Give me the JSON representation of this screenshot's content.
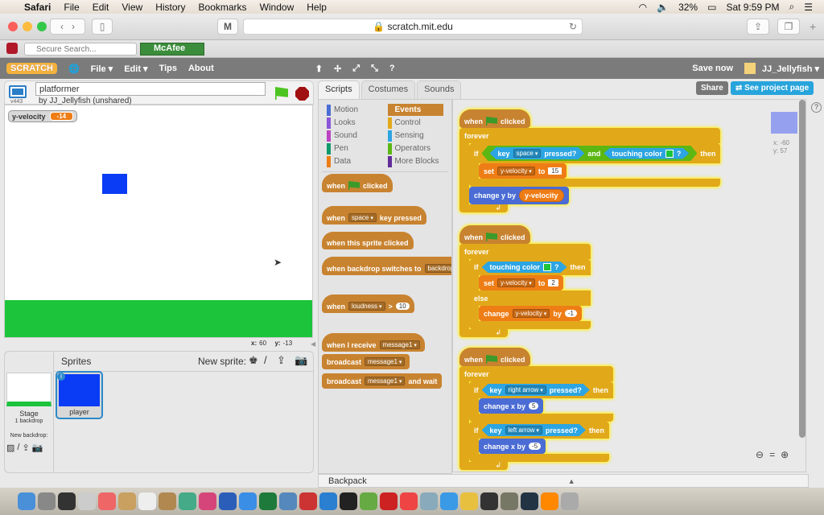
{
  "mac_menu": {
    "apple": "",
    "app": "Safari",
    "items": [
      "File",
      "Edit",
      "View",
      "History",
      "Bookmarks",
      "Window",
      "Help"
    ],
    "battery": "32%",
    "clock": "Sat 9:59 PM"
  },
  "browser": {
    "url": "scratch.mit.edu",
    "search_placeholder": "Secure Search...",
    "mcafee": "McAfee",
    "m_label": "M"
  },
  "scratch_menu": {
    "logo": "SCRATCH",
    "items": [
      "File ▾",
      "Edit ▾",
      "Tips",
      "About"
    ],
    "save": "Save now",
    "user": "JJ_Jellyfish ▾",
    "share": "Share",
    "see_project": "See project page"
  },
  "project": {
    "title": "platformer",
    "author": "by JJ_Jellyfish (unshared)",
    "version": "v443"
  },
  "stage": {
    "monitor_label": "y-velocity",
    "monitor_value": "-14",
    "x_label": "x:",
    "x": "60",
    "y_label": "y:",
    "y": "-13",
    "floor_color": "#1cc43c",
    "player_color": "#0a3cf5"
  },
  "sprites": {
    "title": "Sprites",
    "new_sprite": "New sprite:",
    "stage_label": "Stage",
    "backdrops": "1 backdrop",
    "new_backdrop": "New backdrop:",
    "items": [
      {
        "name": "player"
      }
    ]
  },
  "tabs": [
    "Scripts",
    "Costumes",
    "Sounds"
  ],
  "categories": [
    {
      "name": "Motion",
      "color": "#4a6cd4"
    },
    {
      "name": "Events",
      "color": "#c88330",
      "selected": true
    },
    {
      "name": "Looks",
      "color": "#8a55d7"
    },
    {
      "name": "Control",
      "color": "#e1a91a"
    },
    {
      "name": "Sound",
      "color": "#bb42c3"
    },
    {
      "name": "Sensing",
      "color": "#2ca5e2"
    },
    {
      "name": "Pen",
      "color": "#0e9a6c"
    },
    {
      "name": "Operators",
      "color": "#5cb712"
    },
    {
      "name": "Data",
      "color": "#ee7d16"
    },
    {
      "name": "More Blocks",
      "color": "#632d99"
    }
  ],
  "palette_blocks": [
    {
      "hat": true,
      "cat": "events",
      "parts": [
        "when",
        {
          "icon": "green-flag"
        },
        "clicked"
      ]
    },
    {
      "hat": true,
      "cat": "events",
      "parts": [
        "when",
        {
          "dd": "space"
        },
        "key pressed"
      ]
    },
    {
      "hat": true,
      "cat": "events",
      "parts": [
        "when this sprite clicked"
      ]
    },
    {
      "hat": true,
      "cat": "events",
      "parts": [
        "when backdrop switches to",
        {
          "dd": "backdrop"
        }
      ]
    },
    {
      "hat": true,
      "cat": "events",
      "parts": [
        "when",
        {
          "dd": "loudness"
        },
        ">",
        {
          "num": "10"
        }
      ]
    },
    {
      "hat": true,
      "cat": "events",
      "parts": [
        "when I receive",
        {
          "dd": "message1"
        }
      ]
    },
    {
      "cat": "events",
      "parts": [
        "broadcast",
        {
          "dd": "message1"
        }
      ]
    },
    {
      "cat": "events",
      "parts": [
        "broadcast",
        {
          "dd": "message1"
        },
        "and wait"
      ]
    }
  ],
  "scripts": [
    [
      {
        "hat": true,
        "cat": "events",
        "parts": [
          "when",
          {
            "icon": "green-flag"
          },
          "clicked"
        ]
      },
      {
        "c": "forever",
        "cat": "control",
        "parts": [
          "forever"
        ],
        "body": [
          {
            "c": "if",
            "cat": "control",
            "parts": [
              "if",
              {
                "bool": [
                  {
                    "bool": [
                      "key",
                      {
                        "dd": "space"
                      },
                      "pressed?"
                    ],
                    "cat": "sensing"
                  },
                  "and",
                  {
                    "bool": [
                      "touching color",
                      {
                        "color": "#1cc43c"
                      },
                      "?"
                    ],
                    "cat": "sensing"
                  }
                ],
                "cat": "operators"
              },
              "then"
            ],
            "body": [
              {
                "cat": "data",
                "parts": [
                  "set",
                  {
                    "dd": "y-velocity"
                  },
                  "to",
                  {
                    "sq": "15"
                  }
                ]
              }
            ]
          },
          {
            "cat": "motion",
            "parts": [
              "change y by",
              {
                "rep": "y-velocity",
                "cat": "data"
              }
            ]
          }
        ]
      }
    ],
    [
      {
        "hat": true,
        "cat": "events",
        "parts": [
          "when",
          {
            "icon": "green-flag"
          },
          "clicked"
        ]
      },
      {
        "c": "forever",
        "cat": "control",
        "parts": [
          "forever"
        ],
        "body": [
          {
            "c": "ifelse",
            "cat": "control",
            "parts": [
              "if",
              {
                "bool": [
                  "touching color",
                  {
                    "color": "#1cc43c"
                  },
                  "?"
                ],
                "cat": "sensing"
              },
              "then"
            ],
            "body": [
              {
                "cat": "data",
                "parts": [
                  "set",
                  {
                    "dd": "y-velocity"
                  },
                  "to",
                  {
                    "sq": "2"
                  }
                ]
              }
            ],
            "else_label": "else",
            "else": [
              {
                "cat": "data",
                "parts": [
                  "change",
                  {
                    "dd": "y-velocity"
                  },
                  "by",
                  {
                    "num": "-1"
                  }
                ]
              }
            ]
          }
        ]
      }
    ],
    [
      {
        "hat": true,
        "cat": "events",
        "parts": [
          "when",
          {
            "icon": "green-flag"
          },
          "clicked"
        ]
      },
      {
        "c": "forever",
        "cat": "control",
        "parts": [
          "forever"
        ],
        "body": [
          {
            "c": "if",
            "cat": "control",
            "parts": [
              "if",
              {
                "bool": [
                  "key",
                  {
                    "dd": "right arrow"
                  },
                  "pressed?"
                ],
                "cat": "sensing"
              },
              "then"
            ],
            "body": [
              {
                "cat": "motion",
                "parts": [
                  "change x by",
                  {
                    "num": "5"
                  }
                ]
              }
            ]
          },
          {
            "c": "if",
            "cat": "control",
            "parts": [
              "if",
              {
                "bool": [
                  "key",
                  {
                    "dd": "left arrow"
                  },
                  "pressed?"
                ],
                "cat": "sensing"
              },
              "then"
            ],
            "body": [
              {
                "cat": "motion",
                "parts": [
                  "change x by",
                  {
                    "num": "-5"
                  }
                ]
              }
            ]
          }
        ]
      }
    ]
  ],
  "sprite_info": {
    "x": "x: -60",
    "y": "y: 57"
  },
  "backpack": "Backpack",
  "colors": {
    "events": "#c88330",
    "control": "#e1a91a",
    "data": "#ee7d16",
    "motion": "#4a6cd4",
    "sensing": "#2ca5e2",
    "operators": "#5cb712"
  },
  "dock_icons": [
    "finder",
    "launchpad",
    "dashboard",
    "help",
    "photos",
    "notes",
    "calendar",
    "contacts",
    "chrome",
    "itunes",
    "word",
    "app-store",
    "excel",
    "maps",
    "lastpass",
    "xcode",
    "terminal",
    "minecraft",
    "roblox",
    "ms-remote",
    "preview",
    "safari",
    "chrome2",
    "unity",
    "gimp",
    "steam",
    "vlc",
    "trash"
  ]
}
